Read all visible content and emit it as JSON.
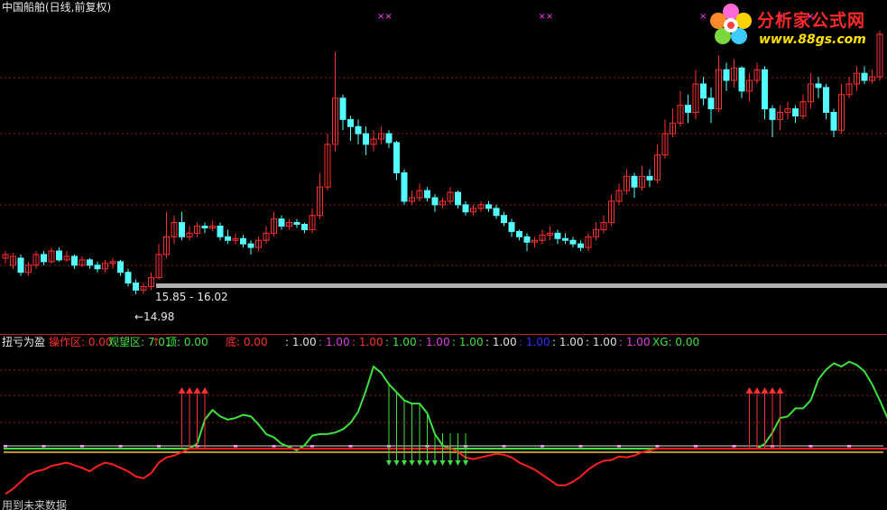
{
  "title": "中国船舶(日线,前复权)",
  "logo": {
    "text": "分析家公式网",
    "url": "www.88gs.com"
  },
  "annotations": {
    "range": "15.85 - 16.02",
    "low": "←14.98"
  },
  "sub_title": "扭亏为盈",
  "footer_note": "用到未来数据",
  "status_items": [
    {
      "text": "操作区: 0.00",
      "color": "#ff3030"
    },
    {
      "text": "观望区: 7.01",
      "color": "#40e040"
    },
    {
      "text": "↑",
      "color": "#ff3030"
    },
    {
      "text": "顶: 0.00",
      "color": "#40e040"
    },
    {
      "text": "底: 0.00",
      "color": "#ff3030"
    },
    {
      "text": ": 1.00",
      "color": "#e0e0e0"
    },
    {
      "text": ": 1.00",
      "color": "#e040e0"
    },
    {
      "text": ": 1.00",
      "color": "#ff3030"
    },
    {
      "text": ": 1.00",
      "color": "#40e040"
    },
    {
      "text": ": 1.00",
      "color": "#e040e0"
    },
    {
      "text": ": 1.00",
      "color": "#40e040"
    },
    {
      "text": ": 1.00",
      "color": "#e0e0e0"
    },
    {
      "text": ": 1.00",
      "color": "#3030ff"
    },
    {
      "text": ": 1.00",
      "color": "#e0e0e0"
    },
    {
      "text": ": 1.00",
      "color": "#e0e0e0"
    },
    {
      "text": ": 1.00",
      "color": "#e040e0"
    },
    {
      "text": "XG: 0.00",
      "color": "#40e040"
    }
  ],
  "colors": {
    "up": "#ff3030",
    "down": "#54ffff",
    "green_line": "#40e040",
    "red_line": "#ff2020",
    "grid": "#8a1a1a",
    "base_bar": "#b0b0b0",
    "marker_x": "#ff40ff"
  },
  "chart_data": [
    {
      "type": "candlestick",
      "title": "中国船舶(日线,前复权)",
      "ylim": [
        14.5,
        22.5
      ],
      "candles": [
        [
          16.0,
          16.1,
          16.2,
          15.85
        ],
        [
          15.8,
          16.05,
          16.15,
          15.7
        ],
        [
          16.0,
          15.6,
          16.1,
          15.5
        ],
        [
          15.6,
          15.8,
          15.9,
          15.5
        ],
        [
          15.8,
          16.1,
          16.2,
          15.7
        ],
        [
          16.1,
          15.9,
          16.2,
          15.8
        ],
        [
          15.9,
          16.2,
          16.3,
          15.85
        ],
        [
          16.2,
          15.95,
          16.3,
          15.9
        ],
        [
          15.95,
          16.05,
          16.2,
          15.9
        ],
        [
          16.05,
          15.8,
          16.1,
          15.7
        ],
        [
          15.8,
          15.95,
          16.05,
          15.75
        ],
        [
          15.95,
          15.8,
          16.0,
          15.7
        ],
        [
          15.8,
          15.7,
          15.9,
          15.6
        ],
        [
          15.7,
          15.85,
          15.95,
          15.6
        ],
        [
          15.85,
          15.9,
          16.0,
          15.7
        ],
        [
          15.9,
          15.6,
          15.95,
          15.5
        ],
        [
          15.6,
          15.3,
          15.7,
          15.2
        ],
        [
          15.3,
          15.1,
          15.4,
          14.98
        ],
        [
          15.1,
          15.2,
          15.3,
          15.0
        ],
        [
          15.2,
          15.45,
          15.6,
          15.1
        ],
        [
          15.45,
          16.1,
          16.4,
          15.4
        ],
        [
          16.1,
          16.6,
          17.3,
          16.0
        ],
        [
          16.6,
          17.0,
          17.2,
          16.4
        ],
        [
          17.0,
          16.6,
          17.3,
          16.5
        ],
        [
          16.6,
          16.7,
          16.9,
          16.5
        ],
        [
          16.7,
          16.9,
          17.0,
          16.6
        ],
        [
          16.9,
          16.85,
          17.0,
          16.7
        ],
        [
          16.85,
          16.9,
          17.05,
          16.75
        ],
        [
          16.9,
          16.6,
          17.0,
          16.5
        ],
        [
          16.6,
          16.5,
          16.8,
          16.4
        ],
        [
          16.5,
          16.55,
          16.7,
          16.4
        ],
        [
          16.55,
          16.4,
          16.65,
          16.3
        ],
        [
          16.4,
          16.3,
          16.5,
          16.1
        ],
        [
          16.3,
          16.5,
          16.6,
          16.2
        ],
        [
          16.5,
          16.7,
          16.9,
          16.4
        ],
        [
          16.7,
          17.1,
          17.3,
          16.6
        ],
        [
          17.1,
          16.9,
          17.2,
          16.8
        ],
        [
          16.9,
          17.0,
          17.1,
          16.8
        ],
        [
          17.0,
          16.95,
          17.1,
          16.85
        ],
        [
          16.95,
          16.8,
          17.0,
          16.7
        ],
        [
          16.8,
          17.2,
          17.4,
          16.7
        ],
        [
          17.2,
          18.0,
          18.4,
          17.1
        ],
        [
          18.0,
          19.2,
          19.5,
          17.9
        ],
        [
          19.2,
          20.5,
          21.8,
          19.0
        ],
        [
          20.5,
          19.9,
          20.6,
          19.6
        ],
        [
          19.9,
          19.7,
          20.0,
          19.3
        ],
        [
          19.7,
          19.5,
          19.9,
          19.2
        ],
        [
          19.5,
          19.2,
          19.7,
          18.9
        ],
        [
          19.2,
          19.35,
          19.6,
          19.0
        ],
        [
          19.35,
          19.5,
          19.7,
          19.2
        ],
        [
          19.5,
          19.25,
          19.6,
          19.1
        ],
        [
          19.25,
          18.4,
          19.3,
          18.2
        ],
        [
          18.4,
          17.6,
          18.5,
          17.5
        ],
        [
          17.6,
          17.7,
          17.9,
          17.5
        ],
        [
          17.7,
          17.9,
          18.1,
          17.6
        ],
        [
          17.9,
          17.7,
          18.0,
          17.6
        ],
        [
          17.7,
          17.5,
          17.8,
          17.3
        ],
        [
          17.5,
          17.6,
          17.7,
          17.4
        ],
        [
          17.6,
          17.85,
          18.0,
          17.5
        ],
        [
          17.85,
          17.5,
          17.9,
          17.4
        ],
        [
          17.5,
          17.3,
          17.6,
          17.2
        ],
        [
          17.3,
          17.4,
          17.5,
          17.2
        ],
        [
          17.4,
          17.5,
          17.6,
          17.3
        ],
        [
          17.5,
          17.4,
          17.6,
          17.3
        ],
        [
          17.4,
          17.2,
          17.5,
          17.1
        ],
        [
          17.2,
          17.0,
          17.3,
          16.9
        ],
        [
          17.0,
          16.75,
          17.1,
          16.6
        ],
        [
          16.75,
          16.6,
          16.8,
          16.5
        ],
        [
          16.6,
          16.45,
          16.7,
          16.2
        ],
        [
          16.45,
          16.5,
          16.6,
          16.3
        ],
        [
          16.5,
          16.65,
          16.8,
          16.4
        ],
        [
          16.65,
          16.7,
          16.9,
          16.5
        ],
        [
          16.7,
          16.55,
          16.8,
          16.4
        ],
        [
          16.55,
          16.5,
          16.7,
          16.4
        ],
        [
          16.5,
          16.4,
          16.6,
          16.3
        ],
        [
          16.4,
          16.3,
          16.5,
          16.2
        ],
        [
          16.3,
          16.6,
          16.7,
          16.2
        ],
        [
          16.6,
          16.8,
          17.0,
          16.5
        ],
        [
          16.8,
          17.0,
          17.2,
          16.7
        ],
        [
          17.0,
          17.6,
          17.8,
          16.9
        ],
        [
          17.6,
          17.9,
          18.1,
          17.5
        ],
        [
          17.9,
          18.3,
          18.5,
          17.8
        ],
        [
          18.3,
          18.0,
          18.4,
          17.7
        ],
        [
          18.0,
          18.3,
          18.6,
          17.9
        ],
        [
          18.3,
          18.2,
          18.5,
          18.0
        ],
        [
          18.2,
          18.9,
          19.2,
          18.1
        ],
        [
          18.9,
          19.5,
          19.9,
          18.8
        ],
        [
          19.5,
          19.8,
          20.2,
          19.4
        ],
        [
          19.8,
          20.3,
          20.7,
          19.7
        ],
        [
          20.3,
          20.1,
          20.6,
          19.8
        ],
        [
          20.1,
          20.9,
          21.3,
          19.9
        ],
        [
          20.9,
          20.5,
          21.1,
          20.3
        ],
        [
          20.5,
          20.2,
          20.8,
          19.8
        ],
        [
          20.2,
          21.3,
          21.7,
          20.1
        ],
        [
          21.3,
          21.0,
          21.5,
          20.7
        ],
        [
          21.0,
          21.35,
          21.6,
          20.8
        ],
        [
          21.35,
          20.7,
          21.4,
          20.5
        ],
        [
          20.7,
          21.0,
          21.2,
          20.4
        ],
        [
          21.0,
          21.3,
          21.5,
          20.9
        ],
        [
          21.3,
          20.2,
          21.4,
          19.9
        ],
        [
          20.2,
          19.9,
          20.3,
          19.4
        ],
        [
          19.9,
          20.1,
          20.3,
          19.6
        ],
        [
          20.1,
          20.2,
          20.4,
          19.9
        ],
        [
          20.2,
          20.0,
          20.3,
          19.8
        ],
        [
          20.0,
          20.4,
          20.6,
          19.9
        ],
        [
          20.4,
          20.9,
          21.2,
          20.2
        ],
        [
          20.9,
          20.8,
          21.1,
          20.5
        ],
        [
          20.8,
          20.1,
          20.9,
          19.9
        ],
        [
          20.1,
          19.6,
          20.2,
          19.4
        ],
        [
          19.6,
          20.6,
          20.9,
          19.5
        ],
        [
          20.6,
          20.9,
          21.1,
          20.5
        ],
        [
          20.9,
          21.2,
          21.4,
          20.7
        ],
        [
          21.2,
          21.0,
          21.4,
          20.9
        ],
        [
          21.0,
          21.1,
          21.3,
          20.9
        ],
        [
          21.1,
          22.3,
          22.4,
          21.0
        ]
      ],
      "top_markers": [
        "××",
        "××",
        "×",
        "×",
        "×",
        "×"
      ]
    },
    {
      "type": "line",
      "title": "扭亏为盈",
      "ylim": [
        -3,
        6
      ],
      "series": [
        {
          "color": "green",
          "values": [
            0,
            0,
            0,
            0,
            0,
            0,
            0,
            0,
            0,
            0,
            0,
            0,
            0,
            0,
            0,
            0,
            0,
            0,
            0,
            0,
            0,
            0,
            0,
            0,
            0,
            0.3,
            1.8,
            2.4,
            2.0,
            1.8,
            1.9,
            2.1,
            2.0,
            1.5,
            0.9,
            0.7,
            0.3,
            0.1,
            -0.1,
            0.2,
            0.8,
            0.9,
            0.9,
            1.0,
            1.2,
            1.6,
            2.3,
            3.6,
            5.1,
            4.7,
            4.0,
            3.5,
            3.0,
            2.8,
            2.8,
            2.2,
            0.9,
            0.2,
            0,
            0,
            0,
            0,
            0,
            0,
            0,
            0,
            0,
            0,
            0,
            0,
            0,
            0,
            0,
            0,
            0,
            0,
            0,
            0,
            0,
            0,
            0,
            0,
            0,
            0,
            0,
            0,
            0,
            0,
            0,
            0,
            0,
            0,
            0,
            0,
            0,
            0,
            0,
            0,
            0,
            0.3,
            1.0,
            1.9,
            2.0,
            2.5,
            2.5,
            3.0,
            4.3,
            4.9,
            5.3,
            5.1,
            5.4,
            5.2,
            4.8,
            4.0,
            3.0,
            1.9,
            1.4,
            1.6,
            1.9,
            1.0,
            0.3,
            0.8,
            0.9,
            1.9
          ]
        },
        {
          "color": "red",
          "values": [
            -2.6,
            -2.3,
            -1.9,
            -1.5,
            -1.3,
            -1.2,
            -1.0,
            -0.9,
            -0.8,
            -0.95,
            -1.1,
            -1.3,
            -1.0,
            -0.8,
            -0.9,
            -1.1,
            -1.3,
            -1.6,
            -1.7,
            -1.4,
            -0.8,
            -0.5,
            -0.4,
            -0.2,
            0,
            0,
            0,
            0,
            0,
            0,
            0,
            0,
            0,
            0,
            0,
            0,
            0,
            0,
            0,
            0,
            0,
            0,
            0,
            0,
            0,
            0,
            0,
            0,
            0,
            0,
            0,
            0,
            0,
            0,
            0,
            0,
            0,
            0,
            0.05,
            -0.2,
            -0.5,
            -0.6,
            -0.5,
            -0.4,
            -0.3,
            -0.35,
            -0.5,
            -0.8,
            -1.0,
            -1.2,
            -1.5,
            -1.8,
            -2.1,
            -2.1,
            -1.9,
            -1.6,
            -1.2,
            -0.9,
            -0.7,
            -0.65,
            -0.45,
            -0.5,
            -0.4,
            -0.2,
            -0.1,
            0,
            0,
            0,
            0,
            0,
            0,
            0,
            0,
            0,
            0,
            0,
            0,
            0,
            0,
            0,
            0,
            0,
            0,
            0,
            0,
            0,
            0,
            0,
            0,
            0,
            0,
            0,
            0,
            0,
            0,
            0,
            0,
            0,
            0,
            0,
            0,
            0,
            0,
            0,
            0,
            0
          ]
        }
      ],
      "buy_arrows": [
        [
          "23",
          "24",
          "25",
          "26"
        ],
        [
          "97",
          "98",
          "99",
          "100",
          "101"
        ]
      ],
      "sell_arrows": [
        "50",
        "51",
        "52",
        "53",
        "54",
        "55",
        "56",
        "57",
        "58",
        "59",
        "60"
      ]
    }
  ]
}
